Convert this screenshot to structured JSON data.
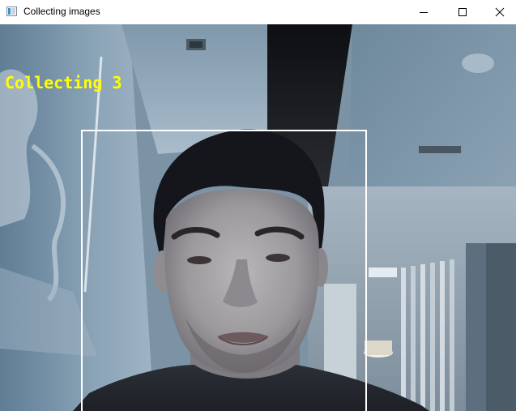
{
  "window": {
    "title": "Collecting images",
    "icon": "opencv-window-icon"
  },
  "controls": {
    "minimize_icon": "minimize-icon",
    "maximize_icon": "maximize-icon",
    "close_icon": "close-icon"
  },
  "overlay": {
    "status_text": "Collecting 3",
    "status_color": "#ffff00",
    "box_color": "#ffffff"
  },
  "colors": {
    "titlebar_bg": "#ffffff",
    "title_text": "#000000"
  }
}
